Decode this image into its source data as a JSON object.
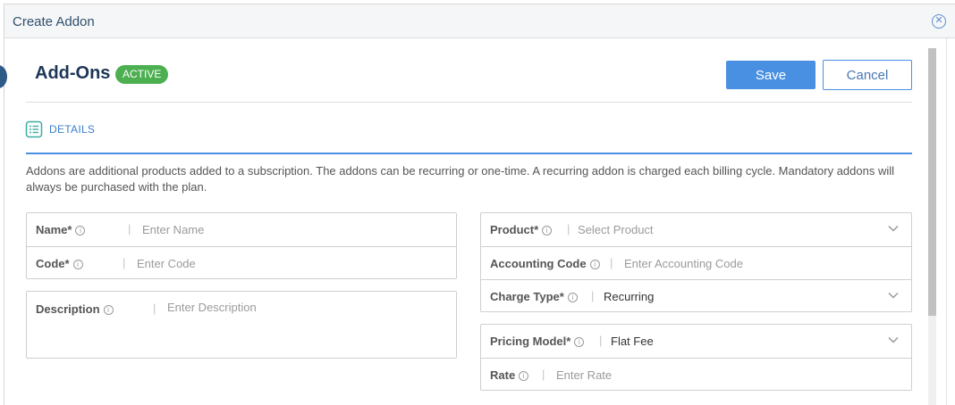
{
  "modal": {
    "title": "Create Addon",
    "close_icon": "close-circle-icon"
  },
  "header": {
    "title": "Add-Ons",
    "status_badge": "ACTIVE"
  },
  "actions": {
    "save_label": "Save",
    "cancel_label": "Cancel"
  },
  "tabs": [
    {
      "label": "DETAILS",
      "icon": "list-icon"
    }
  ],
  "description": "Addons are additional products added to a subscription. The addons can be recurring or one-time. A recurring addon is charged each billing cycle. Mandatory addons will always be purchased with the plan.",
  "separator": "|",
  "left_fields": {
    "name": {
      "label": "Name*",
      "placeholder": "Enter Name",
      "value": ""
    },
    "code": {
      "label": "Code*",
      "placeholder": "Enter Code",
      "value": ""
    },
    "description": {
      "label": "Description",
      "placeholder": "Enter Description",
      "value": ""
    }
  },
  "right_fields": {
    "product": {
      "label": "Product*",
      "placeholder": "Select Product",
      "value": ""
    },
    "accounting_code": {
      "label": "Accounting Code",
      "placeholder": "Enter Accounting Code",
      "value": ""
    },
    "charge_type": {
      "label": "Charge Type*",
      "value": "Recurring"
    },
    "pricing_model": {
      "label": "Pricing Model*",
      "value": "Flat Fee"
    },
    "rate": {
      "label": "Rate",
      "placeholder": "Enter Rate",
      "value": ""
    }
  },
  "colors": {
    "accent": "#4a90e2",
    "badge": "#4caf50",
    "title": "#1d3557"
  }
}
